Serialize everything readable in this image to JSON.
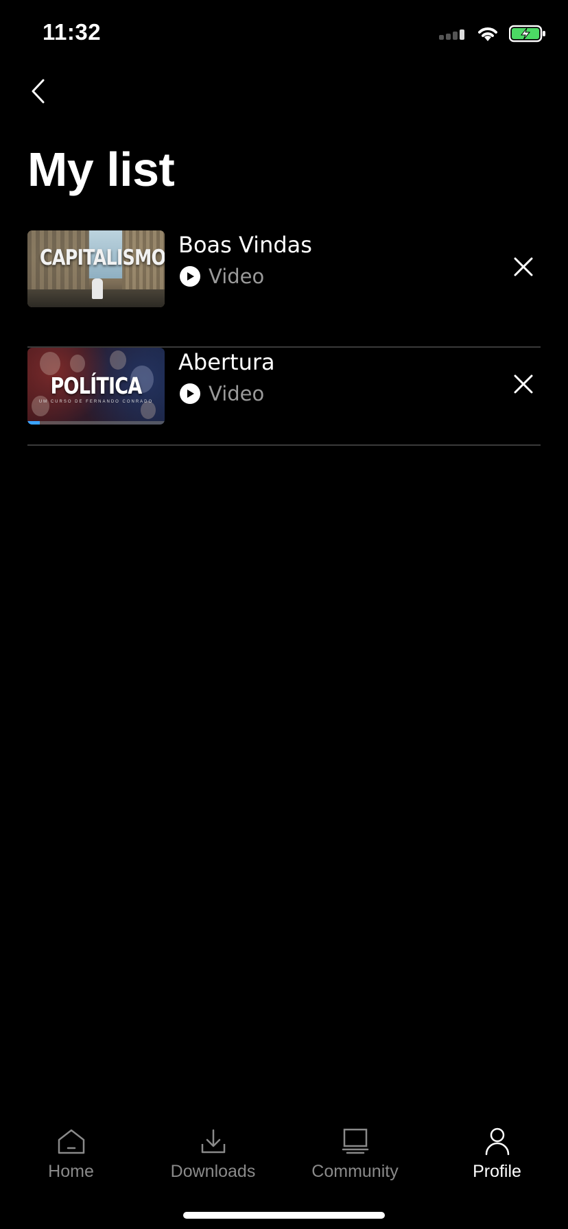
{
  "status_bar": {
    "time": "11:32"
  },
  "header": {
    "title": "My list"
  },
  "list": {
    "items": [
      {
        "title": "Boas Vindas",
        "type": "Video",
        "thumbnail_text": "CAPITALISMO",
        "thumbnail_icon": "city-street-thumbnail"
      },
      {
        "title": "Abertura",
        "type": "Video",
        "thumbnail_text": "POLÍTICA",
        "thumbnail_subtext": "UM CURSO DE FERNANDO CONRADO",
        "thumbnail_icon": "portraits-collage-thumbnail",
        "progress": 0.09
      }
    ]
  },
  "tab_bar": {
    "tabs": [
      {
        "label": "Home",
        "icon": "home-icon",
        "active": false
      },
      {
        "label": "Downloads",
        "icon": "download-icon",
        "active": false
      },
      {
        "label": "Community",
        "icon": "community-icon",
        "active": false
      },
      {
        "label": "Profile",
        "icon": "profile-icon",
        "active": true
      }
    ]
  },
  "colors": {
    "background": "#000000",
    "text": "#ffffff",
    "muted_text": "#9a9a9a",
    "divider": "#3a3a3a",
    "battery_fill": "#4cd964",
    "progress": "#3aa3ff"
  }
}
